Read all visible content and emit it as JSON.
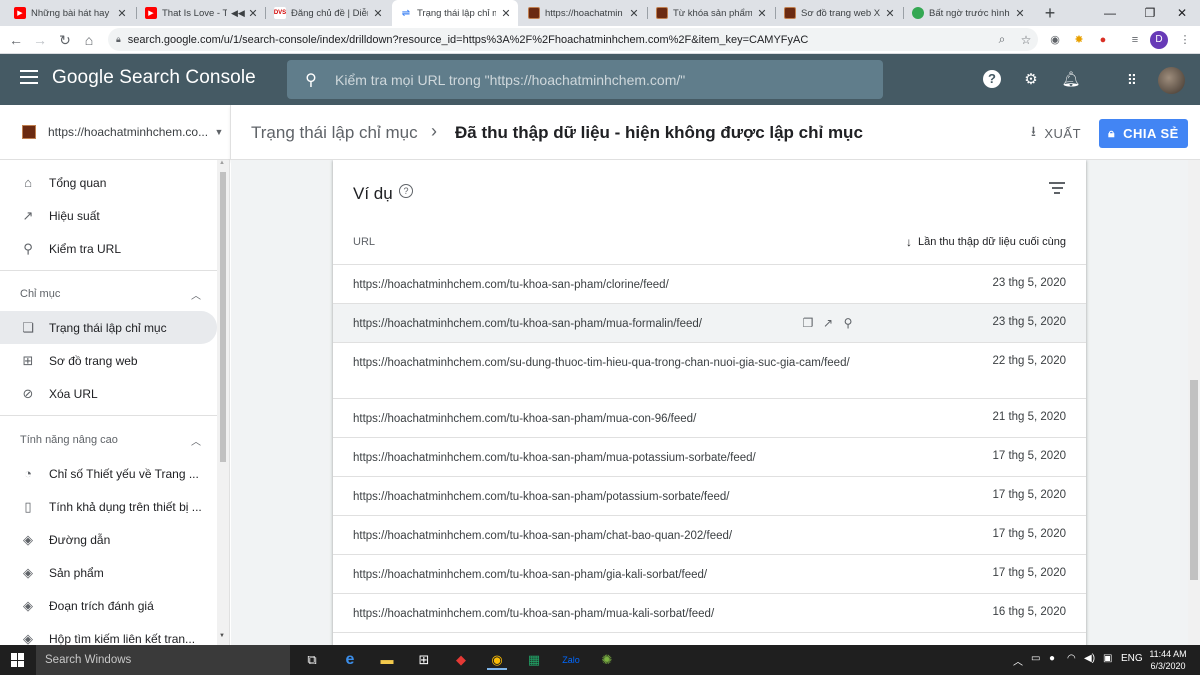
{
  "browser": {
    "tabs": [
      {
        "title": "Những bài hát hay c",
        "icon": "youtube-icon",
        "active": false
      },
      {
        "title": "That Is Love - To",
        "icon": "youtube-icon",
        "active": false
      },
      {
        "title": "Đăng chủ đề | Diễn",
        "icon": "dvs-icon",
        "active": false
      },
      {
        "title": "Trạng thái lập chỉ m",
        "icon": "search-console-icon",
        "active": true
      },
      {
        "title": "https://hoachatmin",
        "icon": "site-icon",
        "active": false
      },
      {
        "title": "Từ khóa sản phẩm",
        "icon": "site-icon",
        "active": false
      },
      {
        "title": "Sơ đồ trang web XM",
        "icon": "site-icon",
        "active": false
      },
      {
        "title": "Bất ngờ trước hình",
        "icon": "globe-icon",
        "active": false
      }
    ],
    "url": "search.google.com/u/1/search-console/index/drilldown?resource_id=https%3A%2F%2Fhoachatminhchem.com%2F&item_key=CAMYFyAC",
    "profile_initial": "D"
  },
  "header": {
    "brand": "Google Search Console",
    "search_placeholder": "Kiểm tra mọi URL trong \"https://hoachatminhchem.com/\""
  },
  "property": {
    "name": "https://hoachatminhchem.co..."
  },
  "breadcrumb": {
    "parent": "Trạng thái lập chỉ mục",
    "current": "Đã thu thập dữ liệu - hiện không được lập chỉ mục",
    "export_label": "XUẤT",
    "share_label": "CHIA SẺ"
  },
  "sidebar": {
    "top_items": [
      {
        "label": "Tổng quan",
        "icon": "home-icon"
      },
      {
        "label": "Hiệu suất",
        "icon": "trend-icon"
      },
      {
        "label": "Kiểm tra URL",
        "icon": "search-icon"
      }
    ],
    "index_section": "Chỉ mục",
    "index_items": [
      {
        "label": "Trạng thái lập chỉ mục",
        "icon": "pages-icon",
        "selected": true
      },
      {
        "label": "Sơ đồ trang web",
        "icon": "sitemap-icon",
        "selected": false
      },
      {
        "label": "Xóa URL",
        "icon": "removal-icon",
        "selected": false
      }
    ],
    "enh_section": "Tính năng nâng cao",
    "enh_items": [
      {
        "label": "Chỉ số Thiết yếu về Trang ...",
        "icon": "speed-icon"
      },
      {
        "label": "Tính khả dụng trên thiết bị ...",
        "icon": "phone-icon"
      },
      {
        "label": "Đường dẫn",
        "icon": "layers-icon"
      },
      {
        "label": "Sản phẩm",
        "icon": "layers-icon"
      },
      {
        "label": "Đoạn trích đánh giá",
        "icon": "layers-icon"
      },
      {
        "label": "Hộp tìm kiếm liên kết tran...",
        "icon": "layers-icon"
      }
    ]
  },
  "table": {
    "title": "Ví dụ",
    "col_url": "URL",
    "col_date": "Lần thu thập dữ liệu cuối cùng",
    "rows": [
      {
        "url": "https://hoachatminhchem.com/tu-khoa-san-pham/clorine/feed/",
        "date": "23 thg 5, 2020"
      },
      {
        "url": "https://hoachatminhchem.com/tu-khoa-san-pham/mua-formalin/feed/",
        "date": "23 thg 5, 2020"
      },
      {
        "url": "https://hoachatminhchem.com/su-dung-thuoc-tim-hieu-qua-trong-chan-nuoi-gia-suc-gia-cam/feed/",
        "date": "22 thg 5, 2020"
      },
      {
        "url": "https://hoachatminhchem.com/tu-khoa-san-pham/mua-con-96/feed/",
        "date": "21 thg 5, 2020"
      },
      {
        "url": "https://hoachatminhchem.com/tu-khoa-san-pham/mua-potassium-sorbate/feed/",
        "date": "17 thg 5, 2020"
      },
      {
        "url": "https://hoachatminhchem.com/tu-khoa-san-pham/potassium-sorbate/feed/",
        "date": "17 thg 5, 2020"
      },
      {
        "url": "https://hoachatminhchem.com/tu-khoa-san-pham/chat-bao-quan-202/feed/",
        "date": "17 thg 5, 2020"
      },
      {
        "url": "https://hoachatminhchem.com/tu-khoa-san-pham/gia-kali-sorbat/feed/",
        "date": "17 thg 5, 2020"
      },
      {
        "url": "https://hoachatminhchem.com/tu-khoa-san-pham/mua-kali-sorbat/feed/",
        "date": "16 thg 5, 2020"
      }
    ]
  },
  "taskbar": {
    "search_placeholder": "Search Windows",
    "lang": "ENG",
    "time": "11:44 AM",
    "date": "6/3/2020"
  },
  "colors": {
    "header_bg": "#455a64",
    "share_blue": "#4285f4",
    "selected_nav": "#e8eaed"
  }
}
